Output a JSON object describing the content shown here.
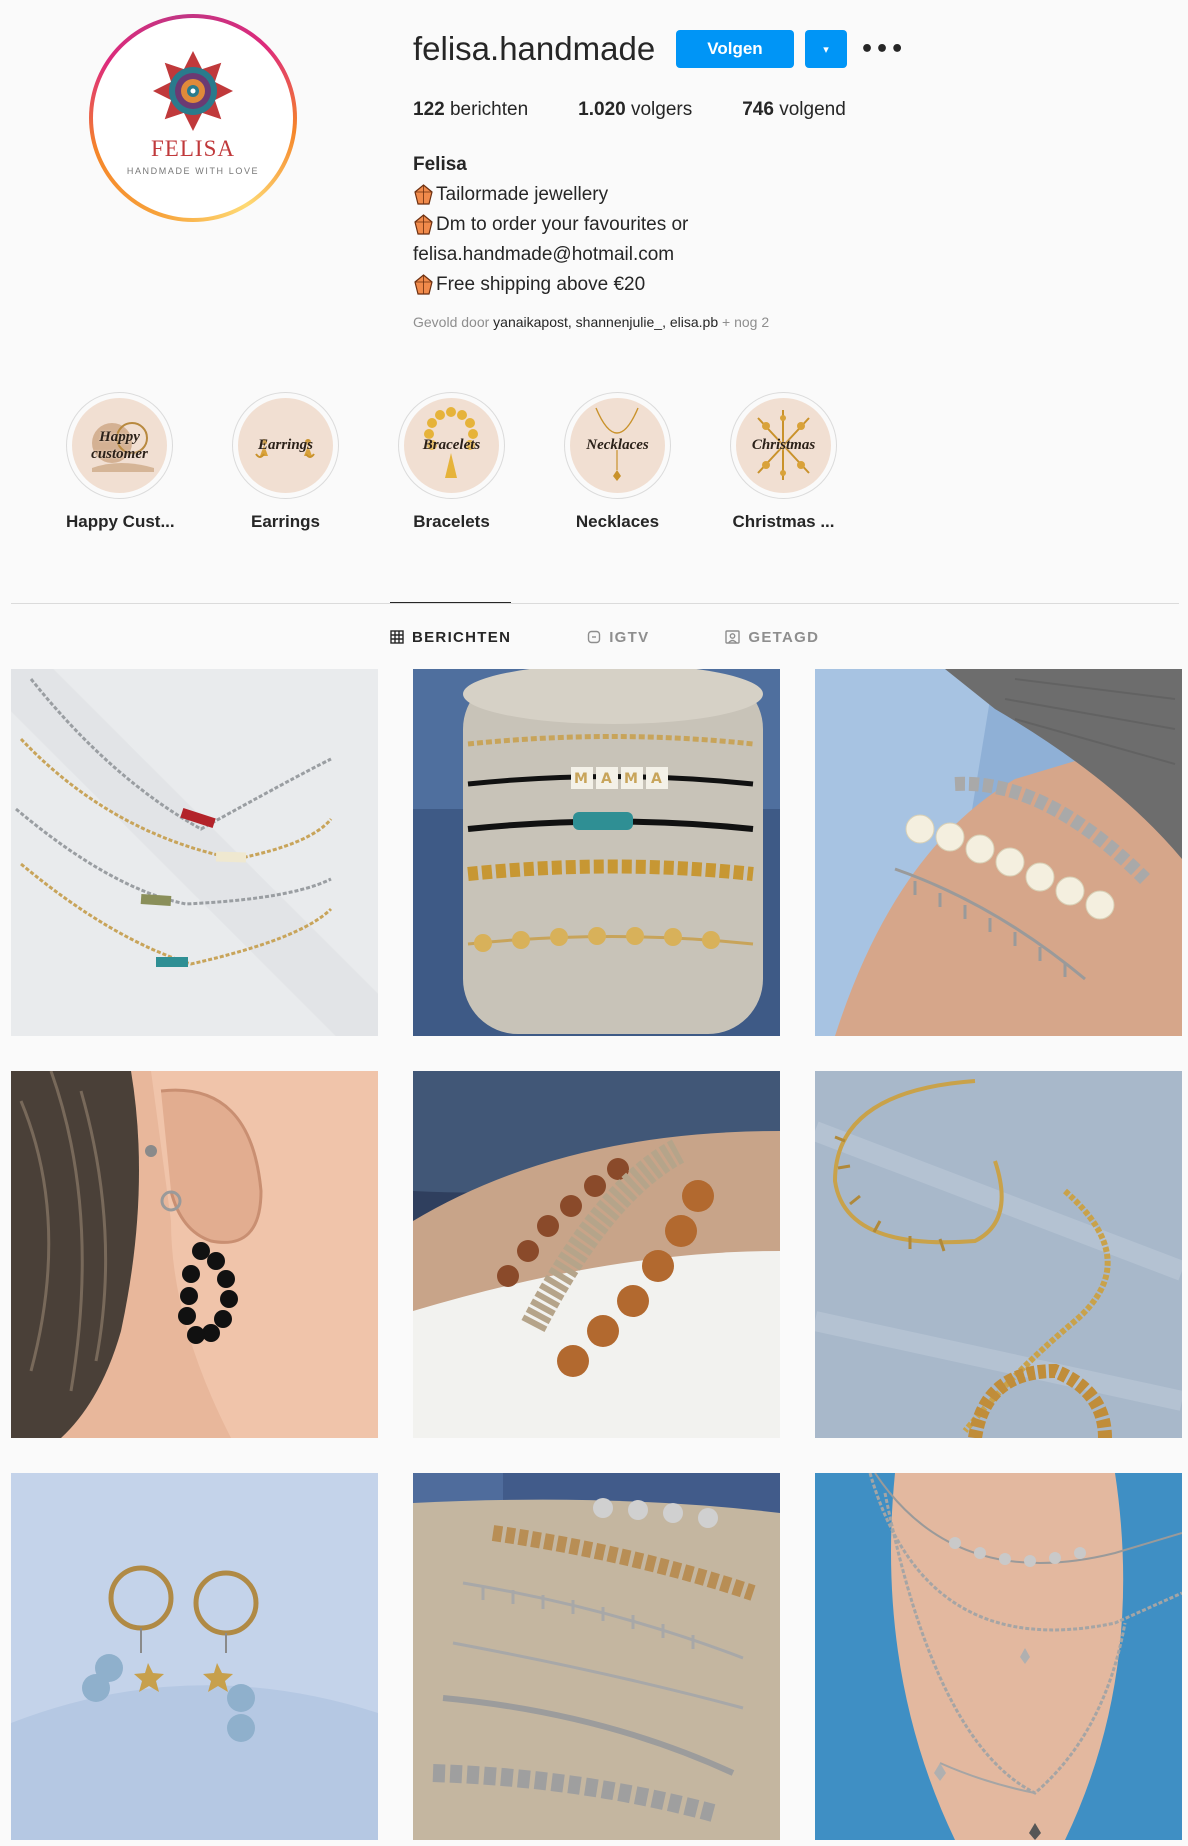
{
  "profile": {
    "username": "felisa.handmade",
    "avatar_brand": "FELISA",
    "avatar_tagline": "HANDMADE WITH LOVE",
    "follow_label": "Volgen",
    "dropdown_label": "▾",
    "more_label": "•••",
    "stats": {
      "posts_count": "122",
      "posts_label": "berichten",
      "followers_count": "1.020",
      "followers_label": "volgers",
      "following_count": "746",
      "following_label": "volgend"
    },
    "bio": {
      "name": "Felisa",
      "lines": [
        "Tailormade jewellery",
        "Dm to order your favourites or",
        "felisa.handmade@hotmail.com",
        "Free shipping above €20"
      ]
    },
    "followed_by": {
      "prefix": "Gevold door ",
      "names": "yanaikapost, shannenjulie_, elisa.pb",
      "suffix": " + nog 2"
    }
  },
  "highlights": [
    {
      "label": "Happy Cust...",
      "cover_title_1": "Happy",
      "cover_title_2": "customer"
    },
    {
      "label": "Earrings",
      "cover_title_1": "Earrings"
    },
    {
      "label": "Bracelets",
      "cover_title_1": "Bracelets"
    },
    {
      "label": "Necklaces",
      "cover_title_1": "Necklaces"
    },
    {
      "label": "Christmas ...",
      "cover_title_1": "Christmas"
    }
  ],
  "tabs": [
    {
      "label": "BERICHTEN",
      "icon": "grid-icon",
      "active": true
    },
    {
      "label": "IGTV",
      "icon": "igtv-icon",
      "active": false
    },
    {
      "label": "GETAGD",
      "icon": "tagged-icon",
      "active": false
    }
  ],
  "posts": [
    {
      "subject": "necklaces"
    },
    {
      "subject": "bracelets-mama"
    },
    {
      "subject": "wrist-bracelets"
    },
    {
      "subject": "ear-hoops"
    },
    {
      "subject": "beaded-bracelets"
    },
    {
      "subject": "gold-chains"
    },
    {
      "subject": "star-earrings"
    },
    {
      "subject": "silver-bracelets"
    },
    {
      "subject": "layered-necklaces"
    }
  ],
  "colors": {
    "accent": "#0095f6",
    "text": "#262626",
    "muted": "#8e8e8e",
    "highlight_bg": "#f1dfd2"
  }
}
